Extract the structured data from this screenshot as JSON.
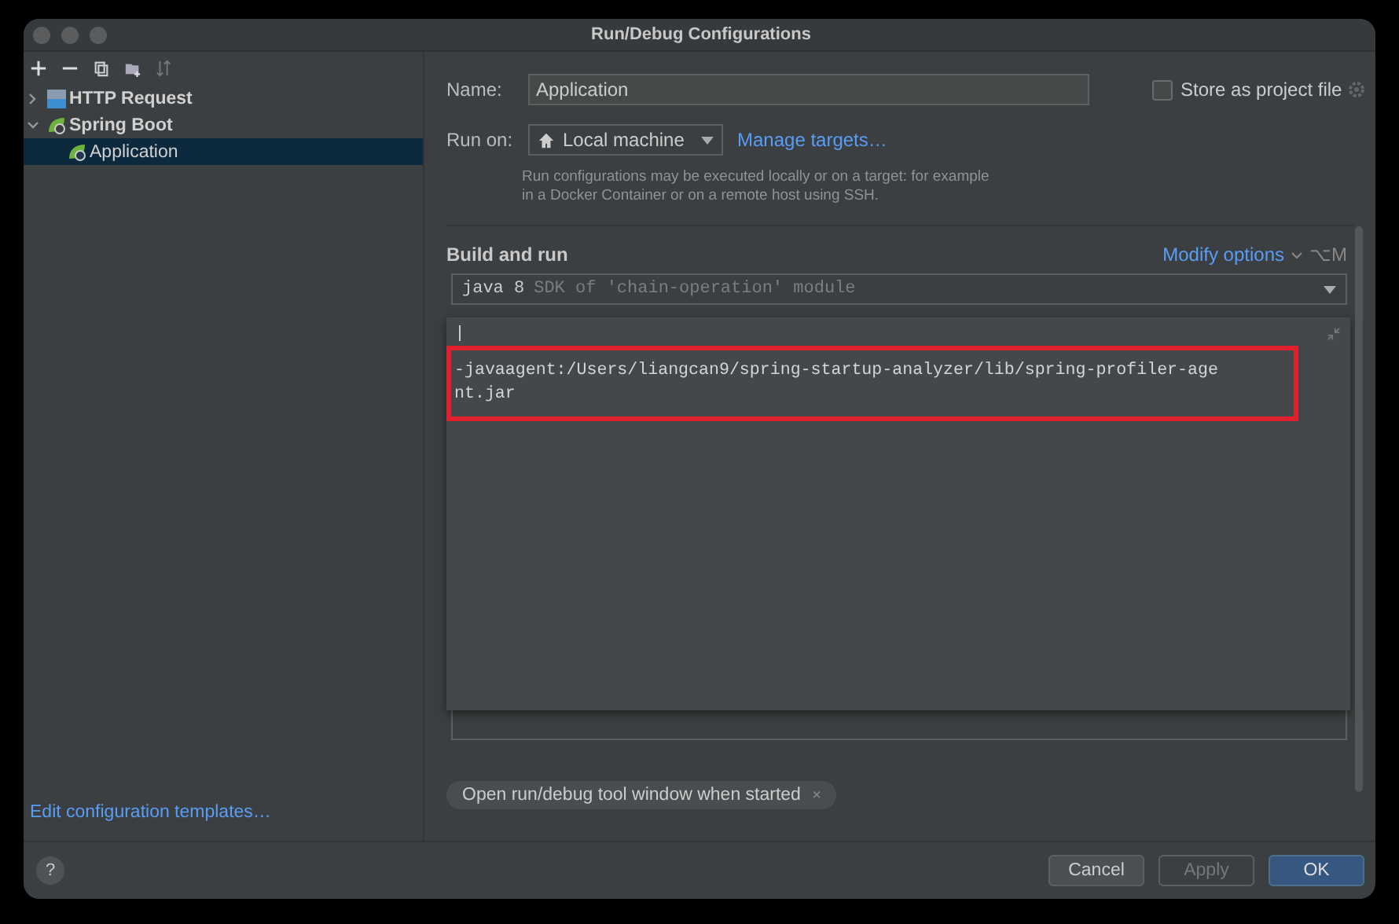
{
  "window": {
    "title": "Run/Debug Configurations"
  },
  "tree": [
    {
      "label": "HTTP Request",
      "kind": "http",
      "expanded": false,
      "selected": false
    },
    {
      "label": "Spring Boot",
      "kind": "spring",
      "expanded": true,
      "selected": false,
      "children": [
        {
          "label": "Application",
          "selected": true
        }
      ]
    }
  ],
  "templates_link": "Edit configuration templates…",
  "form": {
    "name_label": "Name:",
    "name_value": "Application",
    "store": {
      "label": "Store as project file",
      "checked": false
    },
    "run_on_label": "Run on:",
    "run_on_value": "Local machine",
    "manage_link": "Manage targets…",
    "hint": "Run configurations may be executed locally or on a target: for example in a Docker Container or on a remote host using SSH."
  },
  "build_and_run": {
    "heading": "Build and run",
    "modify_options": "Modify options",
    "shortcut": "⌥M",
    "sdk": {
      "name": "java 8",
      "detail": "SDK of 'chain-operation' module"
    },
    "vm_options": {
      "value": "-javaagent:/Users/liangcan9/spring-startup-analyzer/lib/spring-profiler-agent.jar",
      "highlighted": true
    }
  },
  "tags": [
    {
      "label": "Open run/debug tool window when started",
      "close": "×"
    }
  ],
  "help": "?",
  "buttons": [
    {
      "label": "Cancel",
      "disabled": false,
      "default": false
    },
    {
      "label": "Apply",
      "disabled": true,
      "default": false
    },
    {
      "label": "OK",
      "disabled": false,
      "default": true
    }
  ]
}
